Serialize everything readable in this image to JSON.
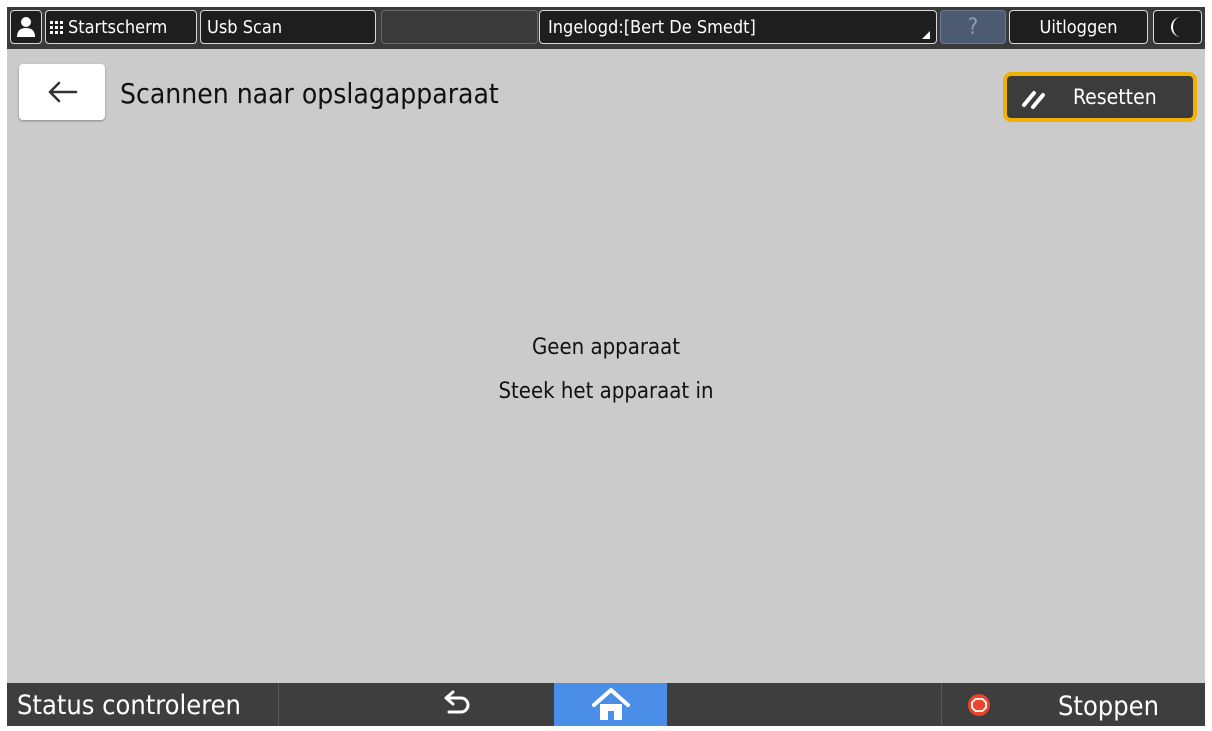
{
  "topbar": {
    "home_label": "Startscherm",
    "app_label": "Usb Scan",
    "login_label": "Ingelogd:[Bert De Smedt]",
    "help_label": "?",
    "logout_label": "Uitloggen"
  },
  "header": {
    "title": "Scannen naar opslagapparaat",
    "reset_label": "Resetten"
  },
  "main": {
    "line1": "Geen apparaat",
    "line2": "Steek het apparaat in"
  },
  "bottombar": {
    "status_label": "Status controleren",
    "stop_label": "Stoppen"
  },
  "colors": {
    "accent": "#f2b100",
    "home_button": "#4a8ee8",
    "stop_icon": "#e8452c",
    "panel": "#cbcbcb"
  },
  "icons": [
    "user-icon",
    "grid-icon",
    "help-icon",
    "moon-icon",
    "back-arrow-icon",
    "reset-icon",
    "return-icon",
    "home-icon",
    "stop-icon"
  ]
}
